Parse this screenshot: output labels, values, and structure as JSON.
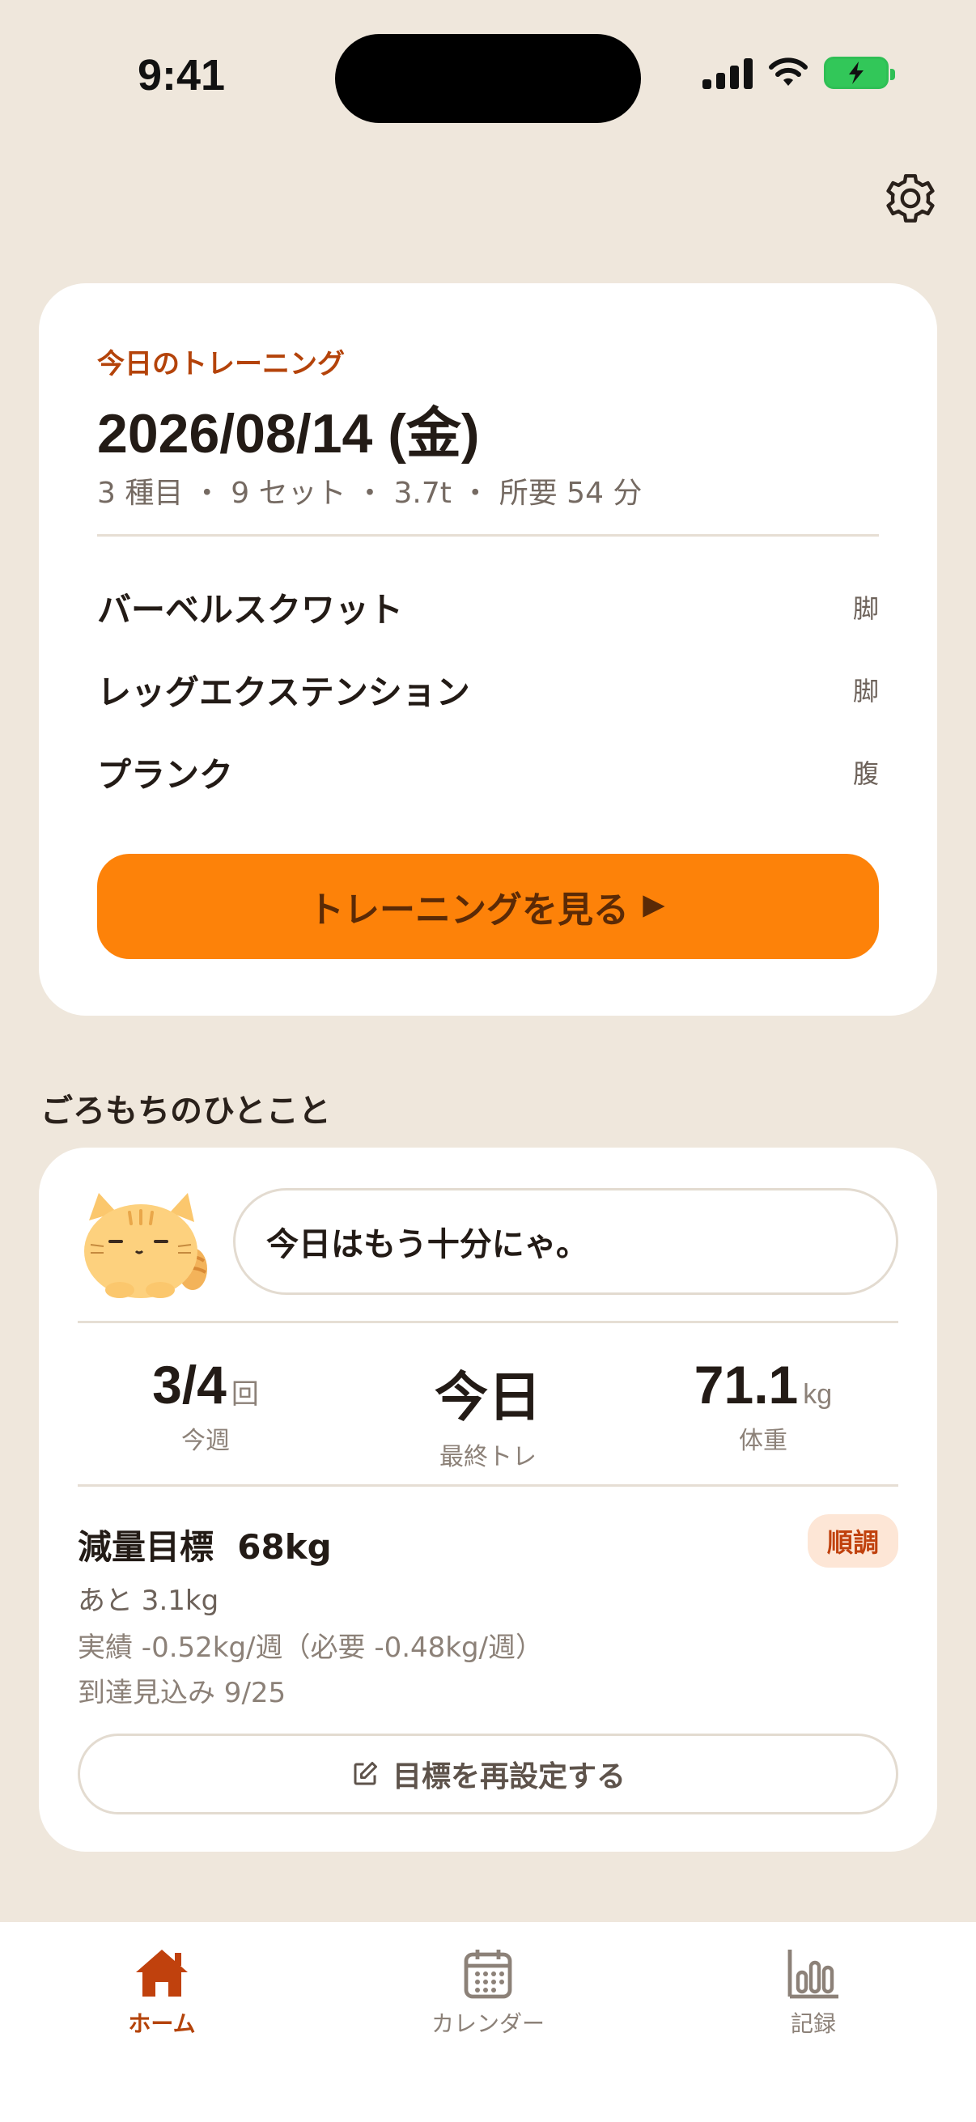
{
  "status_bar": {
    "time": "9:41"
  },
  "training": {
    "eyebrow": "今日のトレーニング",
    "date": "2026/08/14 (金)",
    "meta": "3 種目 ・ 9 セット ・ 3.7t ・ 所要 54 分",
    "exercises": [
      {
        "name": "バーベルスクワット",
        "part": "脚"
      },
      {
        "name": "レッグエクステンション",
        "part": "脚"
      },
      {
        "name": "プランク",
        "part": "腹"
      }
    ],
    "cta_label": "トレーニングを見る"
  },
  "cat_section": {
    "title": "ごろもちのひとこと",
    "message": "今日はもう十分にゃ。",
    "stats": [
      {
        "value": "3/4",
        "unit": "回",
        "label": "今週"
      },
      {
        "value": "今日",
        "unit": "",
        "label": "最終トレ"
      },
      {
        "value": "71.1",
        "unit": "kg",
        "label": "体重"
      }
    ],
    "goal": {
      "title": "減量目標  68kg",
      "badge": "順調",
      "remaining": "あと 3.1kg",
      "pace": "実績 -0.52kg/週（必要 -0.48kg/週）",
      "eta": "到達見込み 9/25",
      "reset_label": "目標を再設定する"
    }
  },
  "tabbar": {
    "items": [
      {
        "label": "ホーム",
        "icon": "home-icon",
        "active": true
      },
      {
        "label": "カレンダー",
        "icon": "calendar-icon",
        "active": false
      },
      {
        "label": "記録",
        "icon": "chart-icon",
        "active": false
      }
    ]
  },
  "colors": {
    "background": "#efe7dc",
    "accent": "#fd8209",
    "accent_text": "#b4430a"
  }
}
